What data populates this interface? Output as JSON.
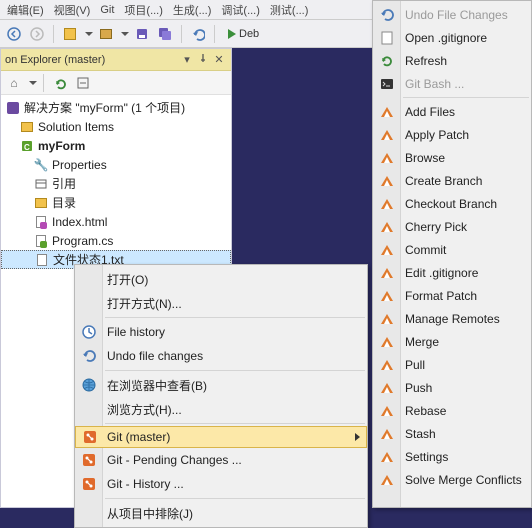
{
  "menubar": {
    "items": [
      "编辑(E)",
      "视图(V)",
      "Git",
      "项目(...)",
      "生成(...)",
      "调试(...)",
      "测试(...)"
    ]
  },
  "toolbar": {
    "debug": "Deb"
  },
  "panel": {
    "title": "on Explorer (master)",
    "solution": "解决方案 \"myForm\" (1 个项目)",
    "items": {
      "sol_items": "Solution Items",
      "project": "myForm",
      "properties": "Properties",
      "refs": "引用",
      "dir": "目录",
      "index": "Index.html",
      "program": "Program.cs",
      "status": "文件状态1.txt"
    }
  },
  "ctx": {
    "open": "打开(O)",
    "open_with": "打开方式(N)...",
    "file_history": "File history",
    "undo_file": "Undo file changes",
    "view_browser": "在浏览器中查看(B)",
    "browse_with": "浏览方式(H)...",
    "git_master": "Git (master)",
    "git_pending": "Git - Pending Changes ...",
    "git_history": "Git - History ...",
    "exclude": "从项目中排除(J)"
  },
  "right": {
    "undo_file": "Undo File Changes",
    "open_gitignore": "Open .gitignore",
    "refresh": "Refresh",
    "git_bash": "Git Bash ...",
    "add_files": "Add Files",
    "apply_patch": "Apply Patch",
    "browse": "Browse",
    "create_branch": "Create Branch",
    "checkout_branch": "Checkout Branch",
    "cherry_pick": "Cherry Pick",
    "commit": "Commit",
    "edit_gitignore": "Edit .gitignore",
    "format_patch": "Format Patch",
    "manage_remotes": "Manage Remotes",
    "merge": "Merge",
    "pull": "Pull",
    "push": "Push",
    "rebase": "Rebase",
    "stash": "Stash",
    "settings": "Settings",
    "solve_conflicts": "Solve Merge Conflicts"
  }
}
